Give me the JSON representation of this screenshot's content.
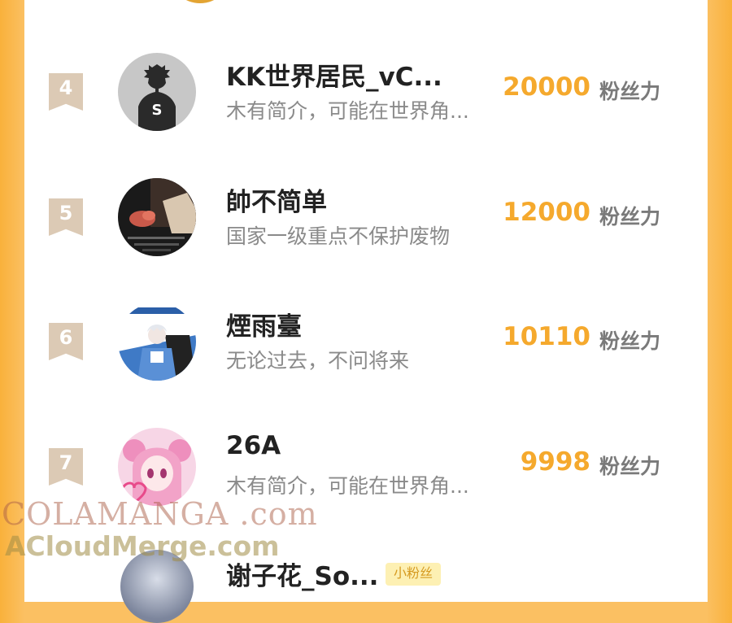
{
  "leaderboard": {
    "rows": [
      {
        "rank": "4",
        "name": "KK世界居民_vC...",
        "bio": "木有简介，可能在世界角...",
        "score": "20000",
        "unit": "粉丝力",
        "avatar": "silhouette-s-avatar"
      },
      {
        "rank": "5",
        "name": "帥不简单",
        "bio": "国家一级重点不保护废物",
        "score": "12000",
        "unit": "粉丝力",
        "avatar": "hand-photo-avatar"
      },
      {
        "rank": "6",
        "name": "煙雨臺",
        "bio": "无论过去，不问将来",
        "score": "10110",
        "unit": "粉丝力",
        "avatar": "anime-boy-avatar"
      },
      {
        "rank": "7",
        "name": "26A",
        "bio": "木有简介，可能在世界角...",
        "score": "9998",
        "unit": "粉丝力",
        "avatar": "anime-girl-avatar"
      }
    ],
    "partial_next": {
      "name": "谢子花_So...",
      "badge": "小粉丝"
    }
  },
  "watermark": {
    "line1": "COLAMANGA .com",
    "line2": "ACloudMerge.com"
  },
  "colors": {
    "background_orange": "#fbc062",
    "score_orange": "#f5a92d",
    "rank_badge": "#dccab5",
    "name_text": "#222222",
    "bio_text": "#8a8a8a"
  }
}
